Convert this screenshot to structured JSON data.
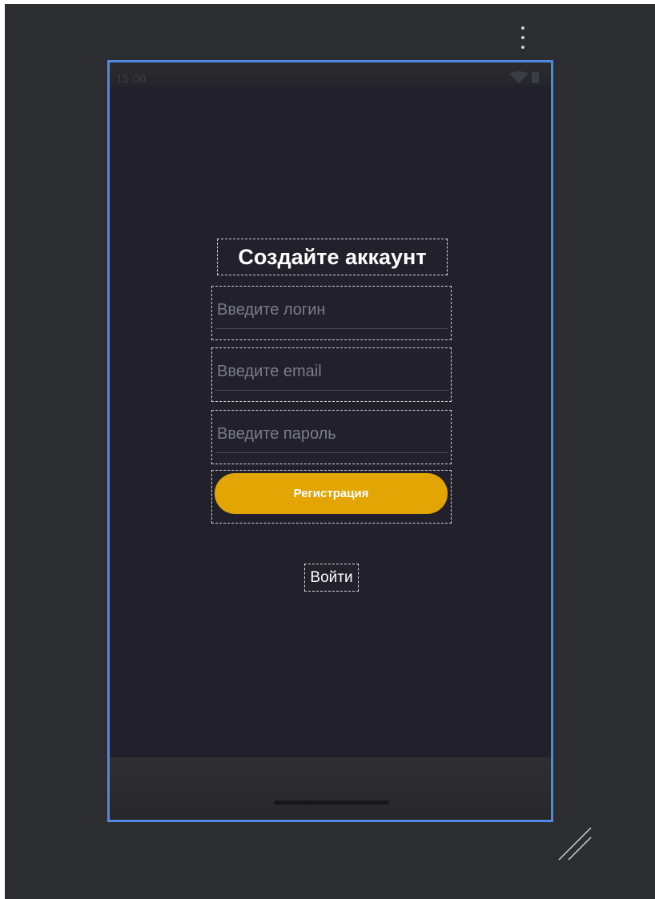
{
  "status_bar": {
    "time": "15:00"
  },
  "screen": {
    "title": "Создайте аккаунт",
    "fields": [
      {
        "placeholder": "Введите логин",
        "value": ""
      },
      {
        "placeholder": "Введите email",
        "value": ""
      },
      {
        "placeholder": "Введите пароль",
        "value": ""
      }
    ],
    "register_label": "Регистрация",
    "login_label": "Войти"
  },
  "colors": {
    "editor_background": "#2b2d30",
    "device_outline": "#4f8ae0",
    "screen_background": "#21202b",
    "accent": "#e3a503"
  },
  "icons": [
    "more-vert-icon",
    "wifi-icon",
    "battery-icon",
    "resize-handle-icon"
  ]
}
